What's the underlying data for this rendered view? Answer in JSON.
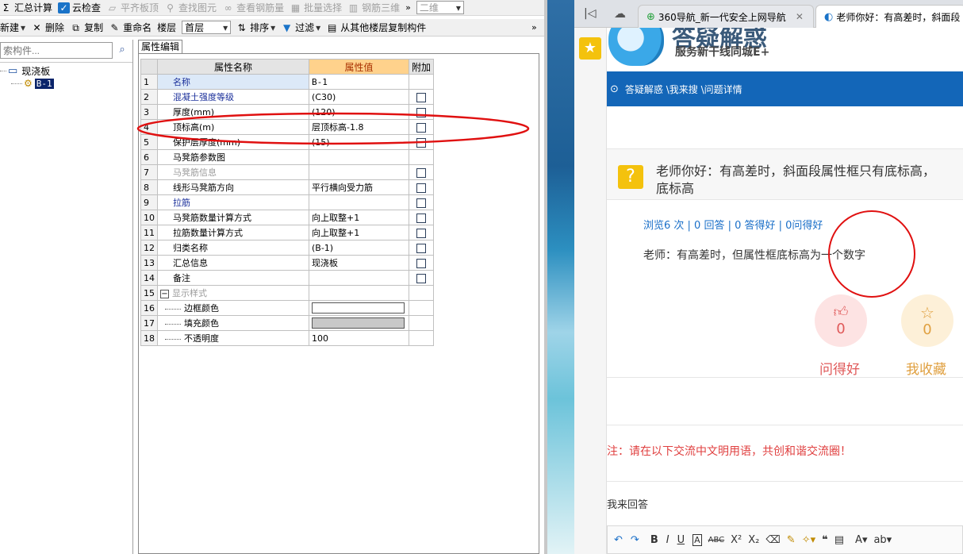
{
  "toolbar1": {
    "summary_calc": "汇总计算",
    "cloud_check": "云检查",
    "align_top": "平齐板顶",
    "find_element": "查找图元",
    "view_rebar": "查看钢筋量",
    "batch_select": "批量选择",
    "rebar_3d": "钢筋三维",
    "view_mode": "二维"
  },
  "toolbar2": {
    "new": "新建",
    "delete": "删除",
    "copy": "复制",
    "rename": "重命名",
    "floor_label": "楼层",
    "floor_value": "首层",
    "sort": "排序",
    "filter": "过滤",
    "copy_from_floor": "从其他楼层复制构件"
  },
  "leftpanel": {
    "search_placeholder": "索构件...",
    "tree_root": "现浇板",
    "tree_child": "B-1"
  },
  "propertypanel": {
    "tab": "属性编辑",
    "headers": {
      "name": "属性名称",
      "value": "属性值",
      "extra": "附加"
    },
    "rows": [
      {
        "num": "1",
        "name": "名称",
        "value": "B-1",
        "checkbox": false
      },
      {
        "num": "2",
        "name": "混凝土强度等级",
        "value": "(C30)",
        "checkbox": true
      },
      {
        "num": "3",
        "name": "厚度(mm)",
        "value": "(120)",
        "checkbox": true
      },
      {
        "num": "4",
        "name": "顶标高(m)",
        "value": "层顶标高-1.8",
        "checkbox": true
      },
      {
        "num": "5",
        "name": "保护层厚度(mm)",
        "value": "(15)",
        "checkbox": true
      },
      {
        "num": "6",
        "name": "马凳筋参数图",
        "value": "",
        "checkbox": false
      },
      {
        "num": "7",
        "name": "马凳筋信息",
        "value": "",
        "checkbox": true
      },
      {
        "num": "8",
        "name": "线形马凳筋方向",
        "value": "平行横向受力筋",
        "checkbox": true
      },
      {
        "num": "9",
        "name": "拉筋",
        "value": "",
        "checkbox": true
      },
      {
        "num": "10",
        "name": "马凳筋数量计算方式",
        "value": "向上取整+1",
        "checkbox": true
      },
      {
        "num": "11",
        "name": "拉筋数量计算方式",
        "value": "向上取整+1",
        "checkbox": true
      },
      {
        "num": "12",
        "name": "归类名称",
        "value": "(B-1)",
        "checkbox": true
      },
      {
        "num": "13",
        "name": "汇总信息",
        "value": "现浇板",
        "checkbox": true
      },
      {
        "num": "14",
        "name": "备注",
        "value": "",
        "checkbox": true
      },
      {
        "num": "15",
        "name": "显示样式",
        "value": "",
        "checkbox": false
      },
      {
        "num": "16",
        "name": "边框颜色",
        "value": "",
        "checkbox": false
      },
      {
        "num": "17",
        "name": "填充颜色",
        "value": "",
        "checkbox": false
      },
      {
        "num": "18",
        "name": "不透明度",
        "value": "100",
        "checkbox": false
      }
    ]
  },
  "browser": {
    "tab1": "360导航_新一代安全上网导航",
    "tab2": "老师你好：有高差时，斜面段",
    "logo_title": "答疑解惑",
    "logo_subtitle": "服务新干线同城E+",
    "breadcrumb": "答疑解惑 \\我来搜 \\问题详情",
    "question_line1": "老师你好：有高差时，斜面段属性框只有底标高，",
    "question_line2": "底标高",
    "stats": "浏览6 次 | 0 回答 | 0 答得好 | 0问得好",
    "answer": "老师：有高差时，但属性框底标高为一个数字",
    "good_count": "0",
    "good_label": "问得好",
    "fav_count": "0",
    "fav_label": "我收藏",
    "notice": "注：请在以下交流中文明用语，共创和谐交流圈！",
    "reply_label": "我来回答"
  },
  "colors": {
    "accent_orange": "#ffd28c",
    "nav_blue": "#1366b8",
    "notice_red": "#e04040",
    "good_pink": "#fde3e3",
    "fav_yellow": "#fdf0d8"
  }
}
